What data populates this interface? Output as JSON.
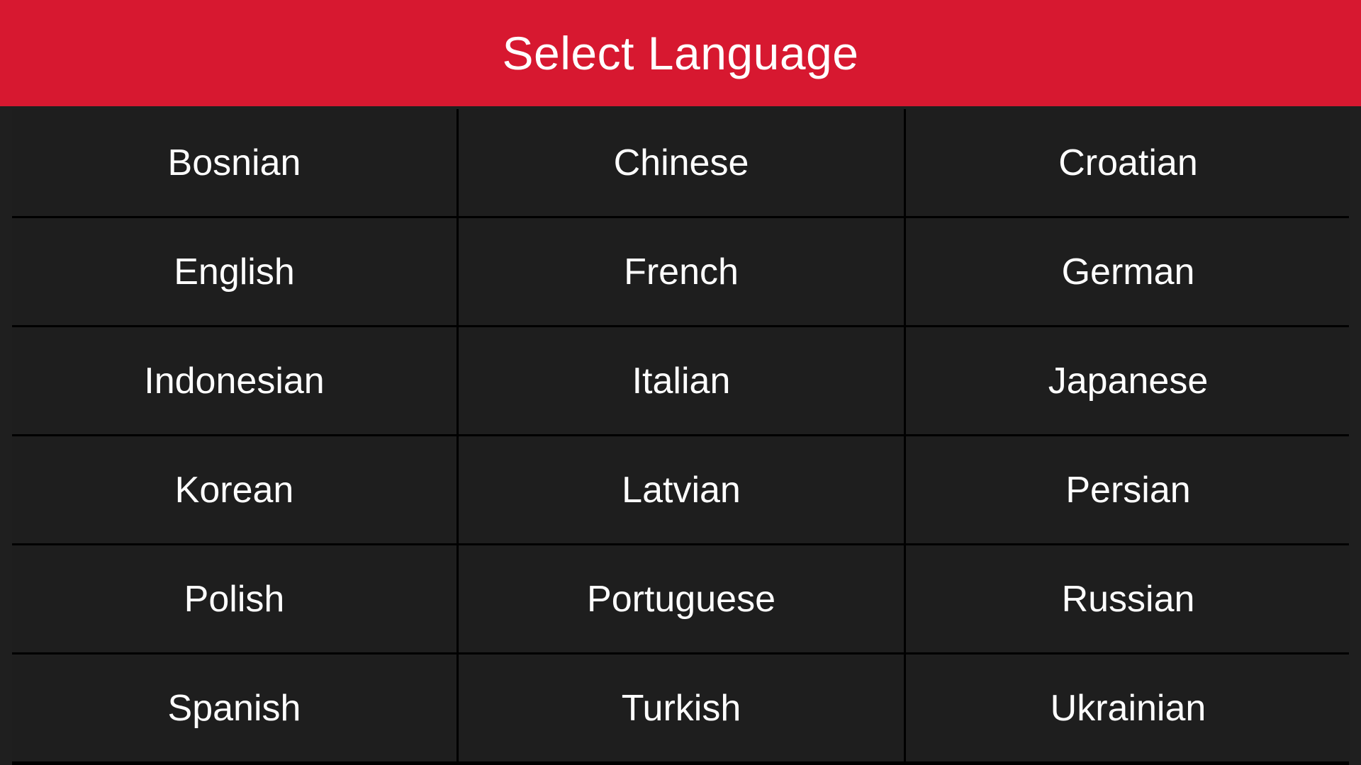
{
  "header": {
    "title": "Select Language"
  },
  "colors": {
    "header_bg": "#d71830",
    "cell_bg": "#1e1e1e",
    "grid_line": "#000000",
    "text": "#ffffff"
  },
  "languages": [
    "Bosnian",
    "Chinese",
    "Croatian",
    "English",
    "French",
    "German",
    "Indonesian",
    "Italian",
    "Japanese",
    "Korean",
    "Latvian",
    "Persian",
    "Polish",
    "Portuguese",
    "Russian",
    "Spanish",
    "Turkish",
    "Ukrainian"
  ]
}
